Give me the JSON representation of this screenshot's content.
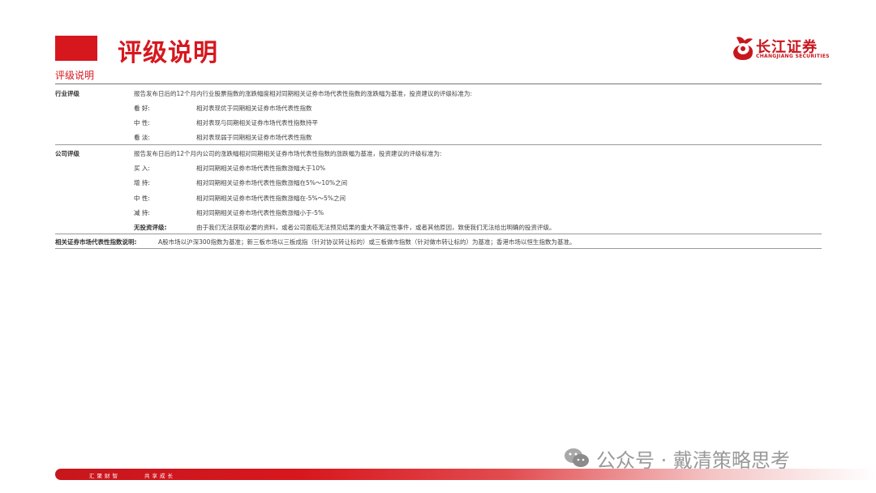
{
  "header": {
    "title": "评级说明",
    "logo_cn": "长江证券",
    "logo_en": "CHANGJIANG SECURITIES"
  },
  "section_label": "评级说明",
  "industry": {
    "category": "行业评级",
    "intro": "报告发布日后的12个月内行业股票指数的涨跌幅度相对同期相关证券市场代表性指数的涨跌幅为基准，投资建议的评级标准为:",
    "items": [
      {
        "term": "看    好:",
        "desc": "相对表现优于同期相关证券市场代表性指数"
      },
      {
        "term": "中    性:",
        "desc": "相对表现与同期相关证券市场代表性指数持平"
      },
      {
        "term": "看    淡:",
        "desc": "相对表现弱于同期相关证券市场代表性指数"
      }
    ]
  },
  "company": {
    "category": "公司评级",
    "intro": "报告发布日后的12个月内公司的涨跌幅相对同期相关证券市场代表性指数的涨跌幅为基准，投资建议的评级标准为:",
    "items": [
      {
        "term": "买    入:",
        "desc": "相对同期相关证券市场代表性指数涨幅大于10%"
      },
      {
        "term": "增    持:",
        "desc": "相对同期相关证券市场代表性指数涨幅在5%～10%之间"
      },
      {
        "term": "中    性:",
        "desc": "相对同期相关证券市场代表性指数涨幅在-5%～5%之间"
      },
      {
        "term": "减    持:",
        "desc": "相对同期相关证券市场代表性指数涨幅小于-5%"
      },
      {
        "term": "无投资评级:",
        "desc": "由于我们无法获取必要的资料，或者公司面临无法预见结果的重大不确定性事件，或者其他原因，致使我们无法给出明确的投资评级。"
      }
    ]
  },
  "footnote": {
    "label": "相关证券市场代表性指数说明:",
    "text": "A股市场以沪深300指数为基准；新三板市场以三板成指（针对协议转让标的）或三板做市指数（针对做市转让标的）为基准；香港市场以恒生指数为基准。"
  },
  "footer": {
    "slogan_left": "汇聚财智",
    "slogan_right": "共享成长"
  },
  "watermark": "公众号 · 戴清策略思考",
  "colors": {
    "brand_red": "#d7171e"
  }
}
